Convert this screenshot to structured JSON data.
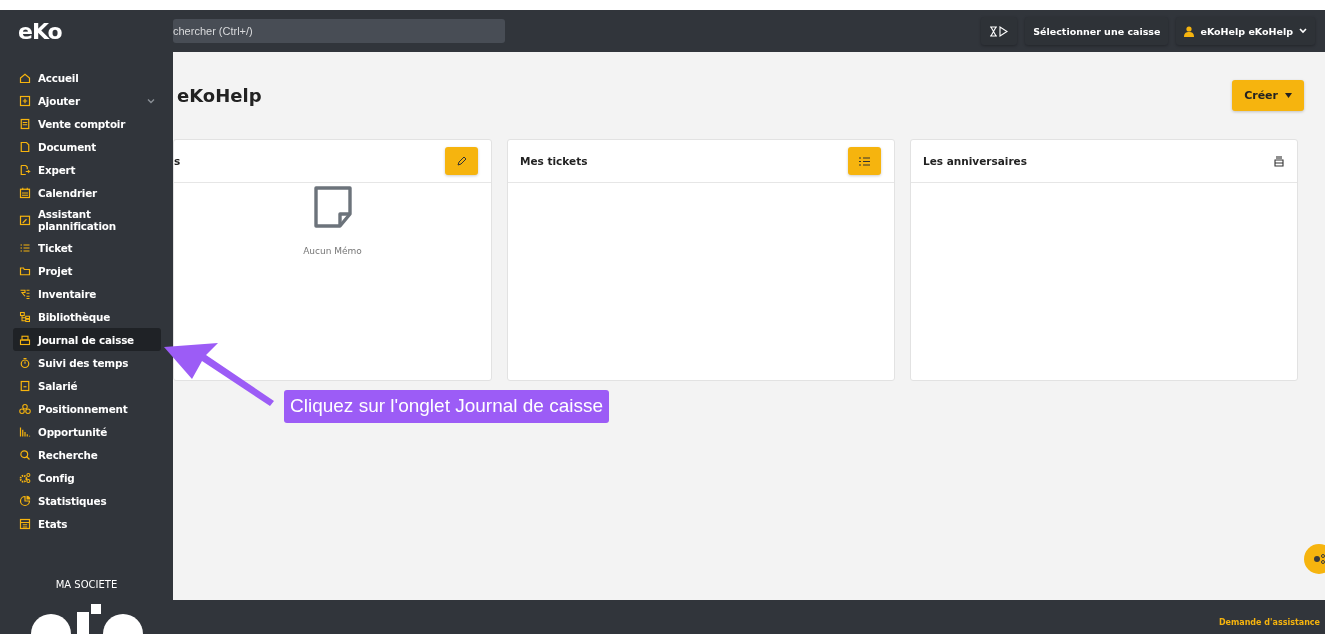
{
  "topbar": {
    "logo": "eKo",
    "search": {
      "placeholder": "chercher (Ctrl+/)"
    },
    "register_button": "Sélectionner une caisse",
    "user": "eKoHelp eKoHelp"
  },
  "sidebar": {
    "items": [
      {
        "label": "Accueil",
        "selected": false,
        "expandable": false
      },
      {
        "label": "Ajouter",
        "selected": false,
        "expandable": true
      },
      {
        "label": "Vente comptoir",
        "selected": false,
        "expandable": false
      },
      {
        "label": "Document",
        "selected": false,
        "expandable": false
      },
      {
        "label": "Expert",
        "selected": false,
        "expandable": false
      },
      {
        "label": "Calendrier",
        "selected": false,
        "expandable": false
      },
      {
        "label": "Assistant plannification",
        "selected": false,
        "expandable": false
      },
      {
        "label": "Ticket",
        "selected": false,
        "expandable": false
      },
      {
        "label": "Projet",
        "selected": false,
        "expandable": false
      },
      {
        "label": "Inventaire",
        "selected": false,
        "expandable": false
      },
      {
        "label": "Bibliothèque",
        "selected": false,
        "expandable": false
      },
      {
        "label": "Journal de caisse",
        "selected": true,
        "expandable": false
      },
      {
        "label": "Suivi des temps",
        "selected": false,
        "expandable": false
      },
      {
        "label": "Salarié",
        "selected": false,
        "expandable": false
      },
      {
        "label": "Positionnement",
        "selected": false,
        "expandable": false
      },
      {
        "label": "Opportunité",
        "selected": false,
        "expandable": false
      },
      {
        "label": "Recherche",
        "selected": false,
        "expandable": false
      },
      {
        "label": "Config",
        "selected": false,
        "expandable": false
      },
      {
        "label": "Statistiques",
        "selected": false,
        "expandable": false
      },
      {
        "label": "Etats",
        "selected": false,
        "expandable": false
      }
    ],
    "company": "MA SOCIETE"
  },
  "page": {
    "title": "eKoHelp",
    "create_button": "Créer"
  },
  "cards": [
    {
      "title": "s",
      "kind": "memo",
      "empty_text": "Aucun Mémo"
    },
    {
      "title": "Mes tickets",
      "kind": "tickets"
    },
    {
      "title": "Les anniversaires",
      "kind": "birthdays"
    }
  ],
  "annotation": {
    "text": "Cliquez sur l'onglet Journal de caisse"
  },
  "footer": {
    "link": "Demande d'assistance"
  }
}
